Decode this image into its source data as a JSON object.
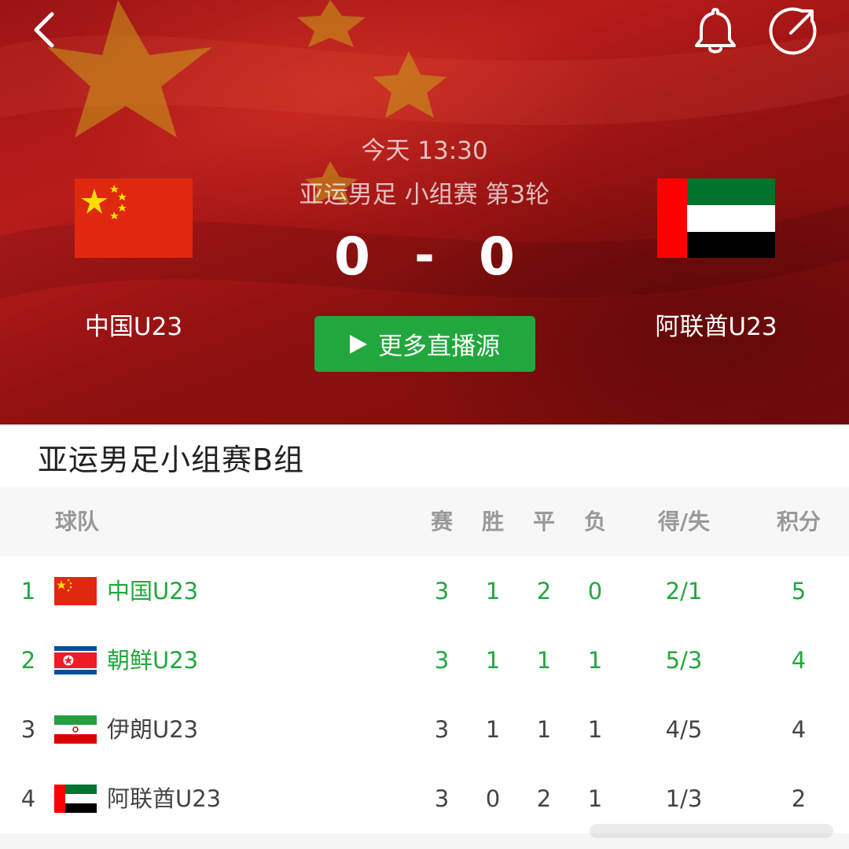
{
  "header": {
    "match_time": "今天 13:30",
    "match_round": "亚运男足 小组赛 第3轮",
    "home_team": "中国U23",
    "away_team": "阿联酋U23",
    "home_score": "0",
    "away_score": "0",
    "separator": "-",
    "live_button_label": "更多直播源",
    "icons": [
      "back-icon",
      "bell-icon",
      "share-icon",
      "play-icon"
    ]
  },
  "standings": {
    "title": "亚运男足小组赛B组",
    "columns": {
      "team": "球队",
      "played": "赛",
      "won": "胜",
      "drawn": "平",
      "lost": "负",
      "goals": "得/失",
      "points": "积分"
    },
    "rows": [
      {
        "rank": "1",
        "team": "中国U23",
        "played": "3",
        "won": "1",
        "drawn": "2",
        "lost": "0",
        "goals": "2/1",
        "points": "5",
        "qualified": true
      },
      {
        "rank": "2",
        "team": "朝鲜U23",
        "played": "3",
        "won": "1",
        "drawn": "1",
        "lost": "1",
        "goals": "5/3",
        "points": "4",
        "qualified": true
      },
      {
        "rank": "3",
        "team": "伊朗U23",
        "played": "3",
        "won": "1",
        "drawn": "1",
        "lost": "1",
        "goals": "4/5",
        "points": "4",
        "qualified": false
      },
      {
        "rank": "4",
        "team": "阿联酋U23",
        "played": "3",
        "won": "0",
        "drawn": "2",
        "lost": "1",
        "goals": "1/3",
        "points": "2",
        "qualified": false
      }
    ]
  },
  "colors": {
    "accent_green": "#22a73e",
    "header_red": "#a8161a",
    "flag_red": "#de2910",
    "flag_yellow": "#ffde00"
  }
}
